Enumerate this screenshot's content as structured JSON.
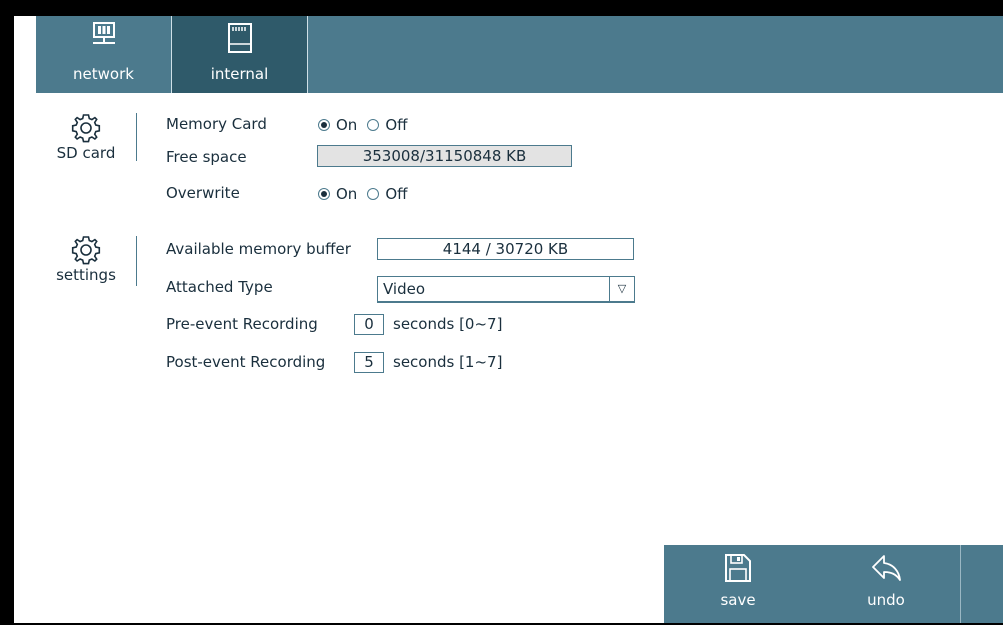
{
  "tabs": [
    {
      "label": "network",
      "icon": "network-icon",
      "active": false
    },
    {
      "label": "internal",
      "icon": "sd-card-icon",
      "active": true
    }
  ],
  "sd_card": {
    "section_label": "SD card",
    "memory_card_label": "Memory Card",
    "memory_card_on": "On",
    "memory_card_off": "Off",
    "memory_card_value": "On",
    "free_space_label": "Free space",
    "free_space_value": "353008/31150848 KB",
    "overwrite_label": "Overwrite",
    "overwrite_on": "On",
    "overwrite_off": "Off",
    "overwrite_value": "On"
  },
  "settings": {
    "section_label": "settings",
    "buffer_label": "Available memory buffer",
    "buffer_value": "4144 / 30720 KB",
    "attached_type_label": "Attached Type",
    "attached_type_value": "Video",
    "pre_event_label": "Pre-event Recording",
    "pre_event_value": "0",
    "pre_event_unit": "seconds [0~7]",
    "post_event_label": "Post-event Recording",
    "post_event_value": "5",
    "post_event_unit": "seconds [1~7]"
  },
  "actions": {
    "save_label": "save",
    "undo_label": "undo"
  },
  "colors": {
    "bar": "#4c7a8d",
    "active_tab": "#2f5a6a",
    "text": "#1a2f3d"
  }
}
